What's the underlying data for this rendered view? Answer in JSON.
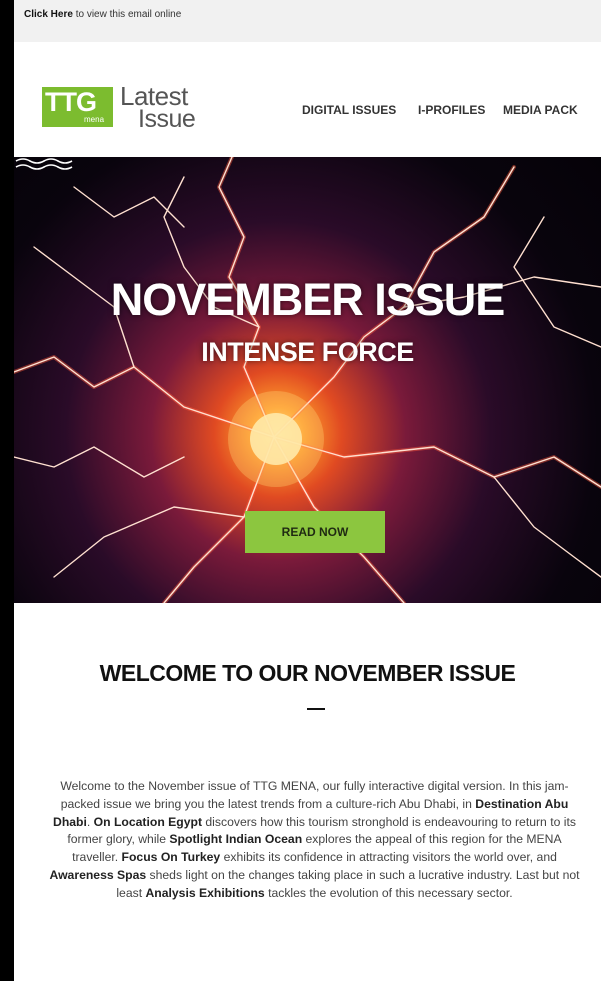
{
  "topbar": {
    "link": "Click Here",
    "rest": " to view this email online"
  },
  "logo": {
    "ttg": "TTG",
    "mena": "mena",
    "latest": "Latest",
    "issue": "Issue"
  },
  "nav": [
    "DIGITAL ISSUES",
    "I-PROFILES",
    "MEDIA PACK"
  ],
  "hero": {
    "title": "NOVEMBER ISSUE",
    "subtitle": "INTENSE FORCE",
    "button": "READ NOW"
  },
  "welcome": {
    "heading": "WELCOME TO OUR NOVEMBER ISSUE"
  },
  "article": [
    {
      "t": "Welcome to the November issue of TTG MENA, our fully interactive digital version. In this jam-packed issue we bring you the latest trends from a culture-rich Abu Dhabi, in ",
      "b": false
    },
    {
      "t": "Destination Abu Dhabi",
      "b": true
    },
    {
      "t": ". ",
      "b": false
    },
    {
      "t": "On Location Egypt",
      "b": true
    },
    {
      "t": " discovers how this tourism stronghold is endeavouring to return to its former glory, while ",
      "b": false
    },
    {
      "t": "Spotlight Indian Ocean",
      "b": true
    },
    {
      "t": " explores the appeal of this region for the MENA traveller. ",
      "b": false
    },
    {
      "t": "Focus On Turkey",
      "b": true
    },
    {
      "t": " exhibits its confidence in attracting visitors the world over, and ",
      "b": false
    },
    {
      "t": "Awareness Spas",
      "b": true
    },
    {
      "t": " sheds light on the changes taking place in such a lucrative industry. Last but not least ",
      "b": false
    },
    {
      "t": "Analysis Exhibitions",
      "b": true
    },
    {
      "t": " tackles the evolution of this necessary sector.",
      "b": false
    }
  ],
  "colors": {
    "accent_green": "#8cc63f",
    "logo_green": "#7cbc2f"
  }
}
